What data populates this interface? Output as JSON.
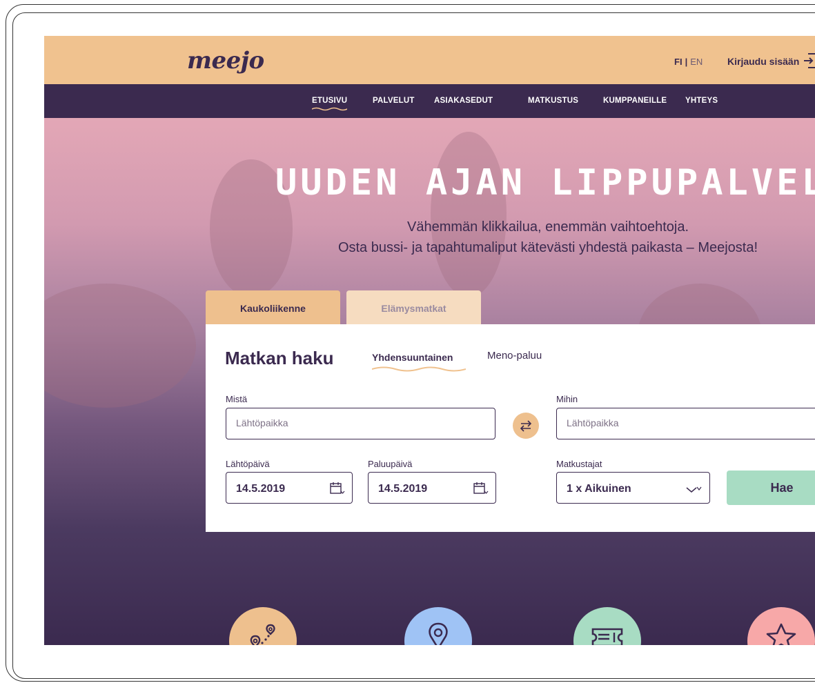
{
  "brand": {
    "logo": "meejo"
  },
  "header": {
    "lang_fi": "FI",
    "lang_sep": "|",
    "lang_en": "EN",
    "login_label": "Kirjaudu sisään"
  },
  "nav": {
    "items": [
      "ETUSIVU",
      "PALVELUT",
      "ASIAKASEDUT",
      "MATKUSTUS",
      "KUMPPANEILLE",
      "YHTEYS"
    ],
    "active": "ETUSIVU"
  },
  "hero": {
    "title": "UUDEN AJAN LIPPUPALVELU",
    "subtitle_line1": "Vähemmän klikkailua, enemmän vaihtoehtoja.",
    "subtitle_line2": "Osta bussi- ja tapahtumaliput kätevästi yhdestä paikasta – Meejosta!"
  },
  "tabs": [
    {
      "label": "Kaukoliikenne",
      "active": true
    },
    {
      "label": "Elämysmatkat",
      "active": false
    }
  ],
  "search": {
    "title": "Matkan haku",
    "trip_one_way": "Yhdensuuntainen",
    "trip_return": "Meno-paluu",
    "from_label": "Mistä",
    "from_placeholder": "Lähtöpaikka",
    "to_label": "Mihin",
    "to_placeholder": "Lähtöpaikka",
    "depart_label": "Lähtöpäivä",
    "depart_value": "14.5.2019",
    "return_label": "Paluupäivä",
    "return_value": "14.5.2019",
    "travelers_label": "Matkustajat",
    "travelers_value": "1 x Aikuinen",
    "submit_label": "Hae"
  },
  "features": [
    {
      "icon": "route-pins-icon",
      "color": "#eec08e"
    },
    {
      "icon": "location-pin-icon",
      "color": "#9fc3f5"
    },
    {
      "icon": "ticket-icon",
      "color": "#a8dcc3"
    },
    {
      "icon": "star-icon",
      "color": "#f7a8a8"
    }
  ],
  "colors": {
    "brand_peach": "#f0c28f",
    "brand_purple": "#3b2a4f",
    "accent_green": "#a8dcc3"
  }
}
